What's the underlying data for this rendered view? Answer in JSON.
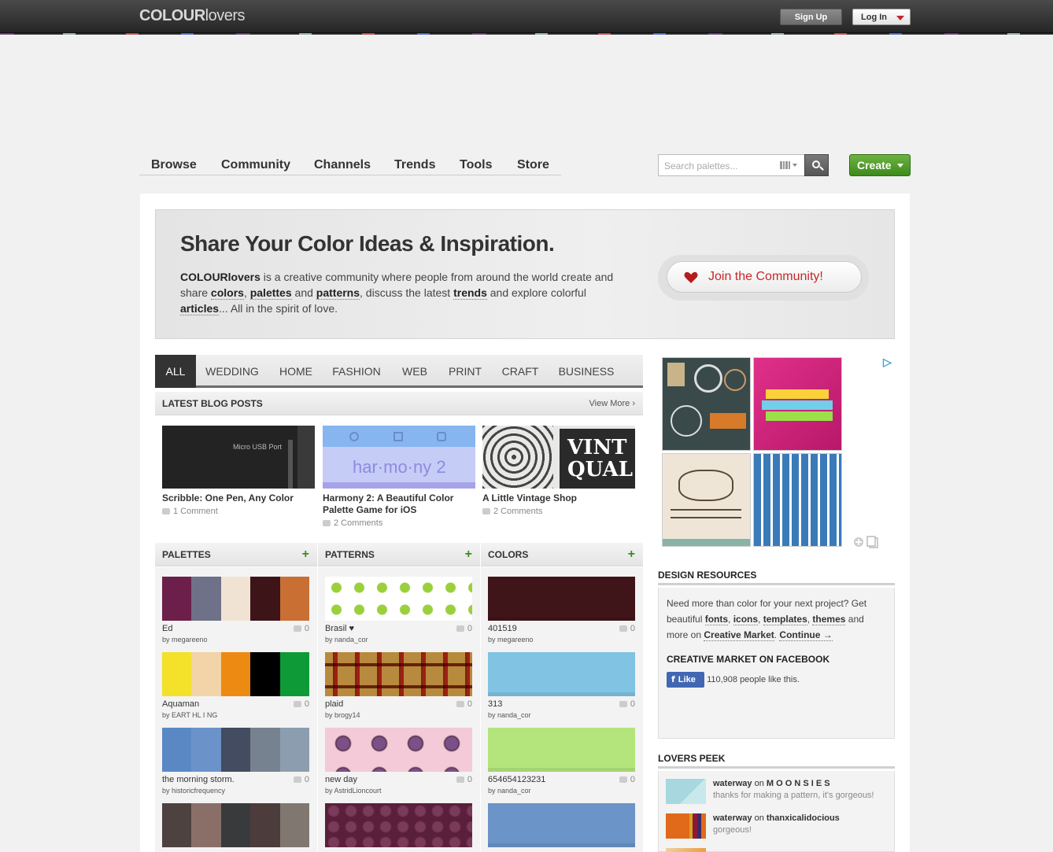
{
  "header": {
    "logo_bold": "COLOUR",
    "logo_light": "lovers",
    "signup": "Sign Up",
    "login": "Log In"
  },
  "nav": [
    "Browse",
    "Community",
    "Channels",
    "Trends",
    "Tools",
    "Store"
  ],
  "search": {
    "placeholder": "Search palettes..."
  },
  "create": "Create",
  "hero": {
    "title": "Share Your Color Ideas & Inspiration.",
    "brand": "COLOURlovers",
    "t1": " is a creative community where people from around the world create and share ",
    "colors": "colors",
    "t2": ", ",
    "palettes": "palettes",
    "t3": " and ",
    "patterns": "patterns",
    "t4": ", discuss the latest ",
    "trends": "trends",
    "t5": " and explore colorful ",
    "articles": "articles",
    "t6": "... All in the spirit of love.",
    "join": "Join the Community!"
  },
  "tabs": [
    "ALL",
    "WEDDING",
    "HOME",
    "FASHION",
    "WEB",
    "PRINT",
    "CRAFT",
    "BUSINESS"
  ],
  "blog": {
    "heading": "LATEST BLOG POSTS",
    "view_more": "View More ›",
    "posts": [
      {
        "title": "Scribble: One Pen, Any Color",
        "comments": "1 Comment",
        "thumb_text": "Micro USB Port"
      },
      {
        "title": "Harmony 2: A Beautiful Color Palette Game for iOS",
        "comments": "2 Comments",
        "thumb_text": "har·mo·ny 2"
      },
      {
        "title": "A Little Vintage Shop",
        "comments": "2 Comments",
        "thumb_text": "VINT QUAL"
      }
    ]
  },
  "sections": {
    "palettes": "PALETTES",
    "patterns": "PATTERNS",
    "colors": "COLORS",
    "plus": "+"
  },
  "palettes": [
    {
      "name": "Ed",
      "by": "by  megareeno",
      "count": "0",
      "colors": [
        "#6b1f4a",
        "#6e7188",
        "#f1e3d3",
        "#3d1519",
        "#c96f33"
      ]
    },
    {
      "name": "Aquaman",
      "by": "by  EART HL I NG",
      "count": "0",
      "colors": [
        "#f3e12a",
        "#f3d3a8",
        "#ed8a12",
        "#000000",
        "#0e9a37"
      ]
    },
    {
      "name": "the morning storm.",
      "by": "by  historicfrequency",
      "count": "0",
      "colors": [
        "#5a88c4",
        "#6b93c9",
        "#434c60",
        "#778290",
        "#8d9db0"
      ]
    },
    {
      "name": "",
      "by": "",
      "count": "",
      "colors": [
        "#4e4241",
        "#8a6f69",
        "#383a3b",
        "#4d3c3c",
        "#807870"
      ]
    }
  ],
  "patterns": [
    {
      "name": "Brasil ♥",
      "by": "by  nanda_cor",
      "count": "0"
    },
    {
      "name": "plaid",
      "by": "by  brogy14",
      "count": "0"
    },
    {
      "name": "new day",
      "by": "by  AstridLioncourt",
      "count": "0"
    },
    {
      "name": "",
      "by": "",
      "count": ""
    }
  ],
  "colors": [
    {
      "name": "401519",
      "by": "by  megareeno",
      "count": "0",
      "hex": "#401519"
    },
    {
      "name": "313",
      "by": "by  nanda_cor",
      "count": "0",
      "hex": "#80c3e3"
    },
    {
      "name": "654654123231",
      "by": "by  nanda_cor",
      "count": "0",
      "hex": "#b4e57d"
    },
    {
      "name": "",
      "by": "",
      "count": "",
      "hex": "#6b94c8"
    }
  ],
  "sidebar": {
    "design_heading": "DESIGN RESOURCES",
    "d1": "Need more than color for your next project? Get beautiful ",
    "fonts": "fonts",
    "d2": ", ",
    "icons": "icons",
    "d3": ", ",
    "templates": "templates",
    "d4": ", ",
    "themes": "themes",
    "d5": " and more on ",
    "market": "Creative Market",
    "d6": ". ",
    "continue": "Continue →",
    "fb_heading": "CREATIVE MARKET ON FACEBOOK",
    "like": "Like",
    "like_count": "110,908 people like this.",
    "peek_heading": "LOVERS PEEK",
    "peek": [
      {
        "user": "waterway",
        "on": " on ",
        "target": "M O O N S I E S",
        "msg": "thanks for making a pattern, it's gorgeous!"
      },
      {
        "user": "waterway",
        "on": " on ",
        "target": "thanxicalidocious",
        "msg": "gorgeous!"
      }
    ]
  }
}
